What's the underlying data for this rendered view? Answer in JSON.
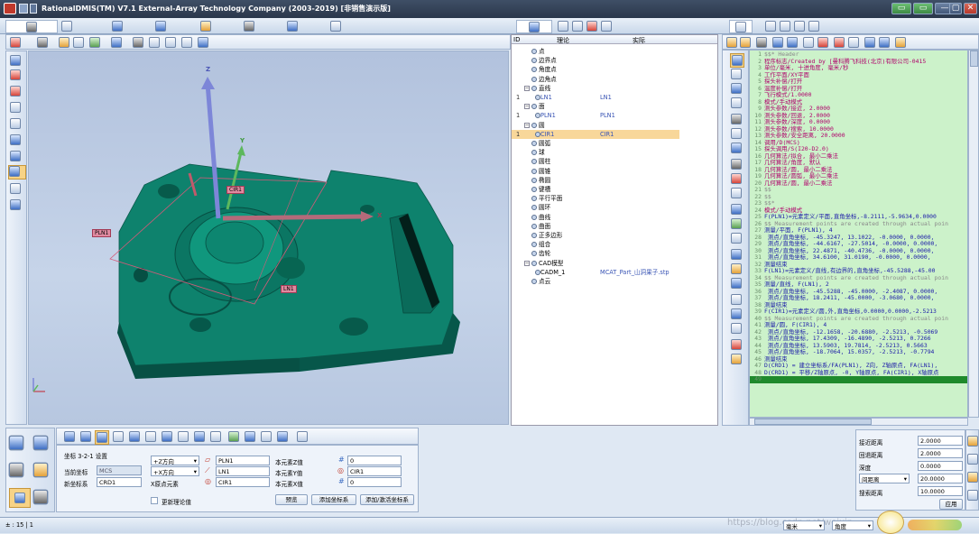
{
  "app": {
    "title": "RationalDMIS(TM) V7.1    External-Array Technology Company (2003-2019) [非销售演示版]"
  },
  "window_buttons": [
    "▭",
    "▭",
    "—",
    "▢",
    "✕"
  ],
  "watermark": "RationalDMIS",
  "tree": {
    "col_id": "ID",
    "col_nominal": "理论",
    "col_actual": "实际",
    "rows": [
      {
        "id": "",
        "label": "点",
        "nom": "",
        "act": ""
      },
      {
        "id": "",
        "label": "边界点",
        "nom": "",
        "act": ""
      },
      {
        "id": "",
        "label": "角度点",
        "nom": "",
        "act": ""
      },
      {
        "id": "",
        "label": "边角点",
        "nom": "",
        "act": ""
      },
      {
        "id": "",
        "label": "直线",
        "nom": "",
        "act": ""
      },
      {
        "id": "1",
        "label": "LN1",
        "nom": "LN1",
        "act": ""
      },
      {
        "id": "",
        "label": "面",
        "nom": "",
        "act": ""
      },
      {
        "id": "1",
        "label": "PLN1",
        "nom": "PLN1",
        "act": ""
      },
      {
        "id": "",
        "label": "圆",
        "nom": "",
        "act": ""
      },
      {
        "id": "1",
        "label": "CIR1",
        "nom": "CIR1",
        "act": "",
        "sel": true
      },
      {
        "id": "",
        "label": "圆弧",
        "nom": "",
        "act": ""
      },
      {
        "id": "",
        "label": "球",
        "nom": "",
        "act": ""
      },
      {
        "id": "",
        "label": "圆柱",
        "nom": "",
        "act": ""
      },
      {
        "id": "",
        "label": "圆锥",
        "nom": "",
        "act": ""
      },
      {
        "id": "",
        "label": "椭圆",
        "nom": "",
        "act": ""
      },
      {
        "id": "",
        "label": "键槽",
        "nom": "",
        "act": ""
      },
      {
        "id": "",
        "label": "平行平面",
        "nom": "",
        "act": ""
      },
      {
        "id": "",
        "label": "圆环",
        "nom": "",
        "act": ""
      },
      {
        "id": "",
        "label": "曲线",
        "nom": "",
        "act": ""
      },
      {
        "id": "",
        "label": "曲面",
        "nom": "",
        "act": ""
      },
      {
        "id": "",
        "label": "正多边形",
        "nom": "",
        "act": ""
      },
      {
        "id": "",
        "label": "组合",
        "nom": "",
        "act": ""
      },
      {
        "id": "",
        "label": "齿轮",
        "nom": "",
        "act": ""
      },
      {
        "id": "",
        "label": "CAD模型",
        "nom": "",
        "act": ""
      },
      {
        "id": "",
        "label": "CADM_1",
        "nom": "MCAT_Part_山洞果子.stp",
        "act": ""
      },
      {
        "id": "",
        "label": "点云",
        "nom": "",
        "act": ""
      }
    ]
  },
  "viewport": {
    "axes": {
      "x": "X",
      "y": "Y",
      "z": "Z"
    },
    "labels": {
      "cir": "CIR1",
      "pln": "PLN1",
      "ln": "LN1"
    }
  },
  "code": {
    "lines": [
      {
        "n": "1",
        "t": "$$* Header",
        "c": "#8a8a8a"
      },
      {
        "n": "2",
        "t": "程序标志/Created by [曼科腾飞科技(北京)有限公司-0415",
        "c": "#b0006b"
      },
      {
        "n": "3",
        "t": "单位/毫米, 十进角度, 毫米/秒",
        "c": "#b0006b"
      },
      {
        "n": "4",
        "t": "工作平面/XY平面",
        "c": "#b0006b"
      },
      {
        "n": "5",
        "t": "探头补偿/打开",
        "c": "#b0006b"
      },
      {
        "n": "6",
        "t": "温度补偿/打开",
        "c": "#b0006b"
      },
      {
        "n": "7",
        "t": "飞行模式/1.0000",
        "c": "#b0006b"
      },
      {
        "n": "8",
        "t": "模式/手动模式",
        "c": "#b0006b"
      },
      {
        "n": "9",
        "t": "测头参数/接近, 2.0000",
        "c": "#b0006b"
      },
      {
        "n": "10",
        "t": "测头参数/回退, 2.0000",
        "c": "#b0006b"
      },
      {
        "n": "11",
        "t": "测头参数/深度, 0.0000",
        "c": "#b0006b"
      },
      {
        "n": "12",
        "t": "测头参数/搜索, 10.0000",
        "c": "#b0006b"
      },
      {
        "n": "13",
        "t": "测头参数/安全距离, 20.0000",
        "c": "#b0006b"
      },
      {
        "n": "14",
        "t": "调用/D(MCS)",
        "c": "#b0006b"
      },
      {
        "n": "15",
        "t": "探头调用/S(I20-D2.0)",
        "c": "#b0006b"
      },
      {
        "n": "16",
        "t": "几何算法/拟合, 最小二乘法",
        "c": "#b0006b"
      },
      {
        "n": "17",
        "t": "几何算法/角度, 默认",
        "c": "#b0006b"
      },
      {
        "n": "18",
        "t": "几何算法/圆, 最小二乘法",
        "c": "#b0006b"
      },
      {
        "n": "19",
        "t": "几何算法/圆弧, 最小二乘法",
        "c": "#b0006b"
      },
      {
        "n": "20",
        "t": "几何算法/圆, 最小二乘法",
        "c": "#b0006b"
      },
      {
        "n": "21",
        "t": "$$",
        "c": "#8a8a8a"
      },
      {
        "n": "22",
        "t": "$$",
        "c": "#8a8a8a"
      },
      {
        "n": "23",
        "t": "$$*",
        "c": "#8a8a8a"
      },
      {
        "n": "24",
        "t": "模式/手动模式",
        "c": "#b0006b"
      },
      {
        "n": "25",
        "t": "F(PLN1)=元素定义/平面,直角坐标,-8.2111,-5.9634,0.0000",
        "c": "#1a1aa8"
      },
      {
        "n": "26",
        "t": "$$ Measurement points are created through actual poin",
        "c": "#8a8a8a"
      },
      {
        "n": "27",
        "t": "测量/平面, F(PLN1), 4",
        "c": "#1a1aa8"
      },
      {
        "n": "28",
        "t": "  测点/直角坐标, -45.3247,  13.1022, -0.0000, 0.0000,",
        "c": "#1a1aa8"
      },
      {
        "n": "29",
        "t": "  测点/直角坐标, -44.6167, -27.5014, -0.0000, 0.0000,",
        "c": "#1a1aa8"
      },
      {
        "n": "30",
        "t": "  测点/直角坐标,  22.4871, -40.4736, -0.0000, 0.0000,",
        "c": "#1a1aa8"
      },
      {
        "n": "31",
        "t": "  测点/直角坐标,  34.6100,  31.0190, -0.0000, 0.0000,",
        "c": "#1a1aa8"
      },
      {
        "n": "32",
        "t": "测量结束",
        "c": "#1a1aa8"
      },
      {
        "n": "33",
        "t": "F(LN1)=元素定义/直线,有边界的,直角坐标,-45.5288,-45.00",
        "c": "#1a1aa8"
      },
      {
        "n": "34",
        "t": "$$ Measurement points are created through actual poin",
        "c": "#8a8a8a"
      },
      {
        "n": "35",
        "t": "测量/直线, F(LN1), 2",
        "c": "#1a1aa8"
      },
      {
        "n": "36",
        "t": "  测点/直角坐标, -45.5288, -45.0000, -2.4087, 0.0000,",
        "c": "#1a1aa8"
      },
      {
        "n": "37",
        "t": "  测点/直角坐标,  18.2411, -45.0000, -3.0680, 0.0000,",
        "c": "#1a1aa8"
      },
      {
        "n": "38",
        "t": "测量结束",
        "c": "#1a1aa8"
      },
      {
        "n": "39",
        "t": "F(CIR1)=元素定义/圆,外,直角坐标,0.0000,0.0000,-2.5213",
        "c": "#1a1aa8"
      },
      {
        "n": "40",
        "t": "$$ Measurement points are created through actual poin",
        "c": "#8a8a8a"
      },
      {
        "n": "41",
        "t": "测量/圆, F(CIR1), 4",
        "c": "#1a1aa8"
      },
      {
        "n": "42",
        "t": "  测点/直角坐标, -12.1658, -20.6880, -2.5213, -0.5069",
        "c": "#1a1aa8"
      },
      {
        "n": "43",
        "t": "  测点/直角坐标,  17.4309, -16.4890, -2.5213,  0.7266",
        "c": "#1a1aa8"
      },
      {
        "n": "44",
        "t": "  测点/直角坐标,  13.5903,  19.7814, -2.5213,  0.5663",
        "c": "#1a1aa8"
      },
      {
        "n": "45",
        "t": "  测点/直角坐标, -18.7064,  15.0357, -2.5213, -0.7794",
        "c": "#1a1aa8"
      },
      {
        "n": "46",
        "t": "测量结束",
        "c": "#1a1aa8"
      },
      {
        "n": "47",
        "t": "D(CRD1) = 建立坐标系/FA(PLN1), Z向, Z轴原点, FA(LN1),",
        "c": "#1a1aa8"
      },
      {
        "n": "48",
        "t": "D(CRD1) = 平移/Z轴原点, -0, Y轴原点, FA(CIR1), X轴原点",
        "c": "#1a1aa8"
      },
      {
        "n": "49",
        "t": "",
        "c": "#000"
      }
    ]
  },
  "csys": {
    "title": "坐标 3-2-1 设置",
    "current_label": "当前坐标",
    "current_value": "MCS",
    "new_label": "新坐标系",
    "new_value": "CRD1",
    "dir1": "+Z方向",
    "dir2": "+X方向",
    "dir3_label": "X原点元素",
    "feat1": "PLN1",
    "feat2": "LN1",
    "feat3": "CIR1",
    "zval_label": "本元素Z值",
    "yval_label": "本元素Y值",
    "xval_label": "本元素X值",
    "zval": "0",
    "yval": "CIR1",
    "xval": "0",
    "update_label": "更新理论值",
    "btn_preview": "预览",
    "btn_add": "添加坐标系",
    "btn_add_select": "添加/激活坐标系"
  },
  "params": {
    "approach_label": "接近距离",
    "approach": "2.0000",
    "retract_label": "回退距离",
    "retract": "2.0000",
    "depth_label": "深度",
    "depth": "0.0000",
    "clearance_option": "间距离",
    "clearance": "20.0000",
    "search_label": "搜索距离",
    "search": "10.0000",
    "apply": "应用"
  },
  "status": {
    "left": "± : 15 | 1",
    "dropdown1": "毫米",
    "dropdown2": "角度",
    "url": "https://blog.csdn.net/weixin..."
  },
  "colors": {
    "model": "#0d7d69",
    "model_top": "#139a80",
    "viewport_bg": "#b5c6e0",
    "code_bg": "#ccf2ca",
    "accent": "#f4c16a"
  }
}
